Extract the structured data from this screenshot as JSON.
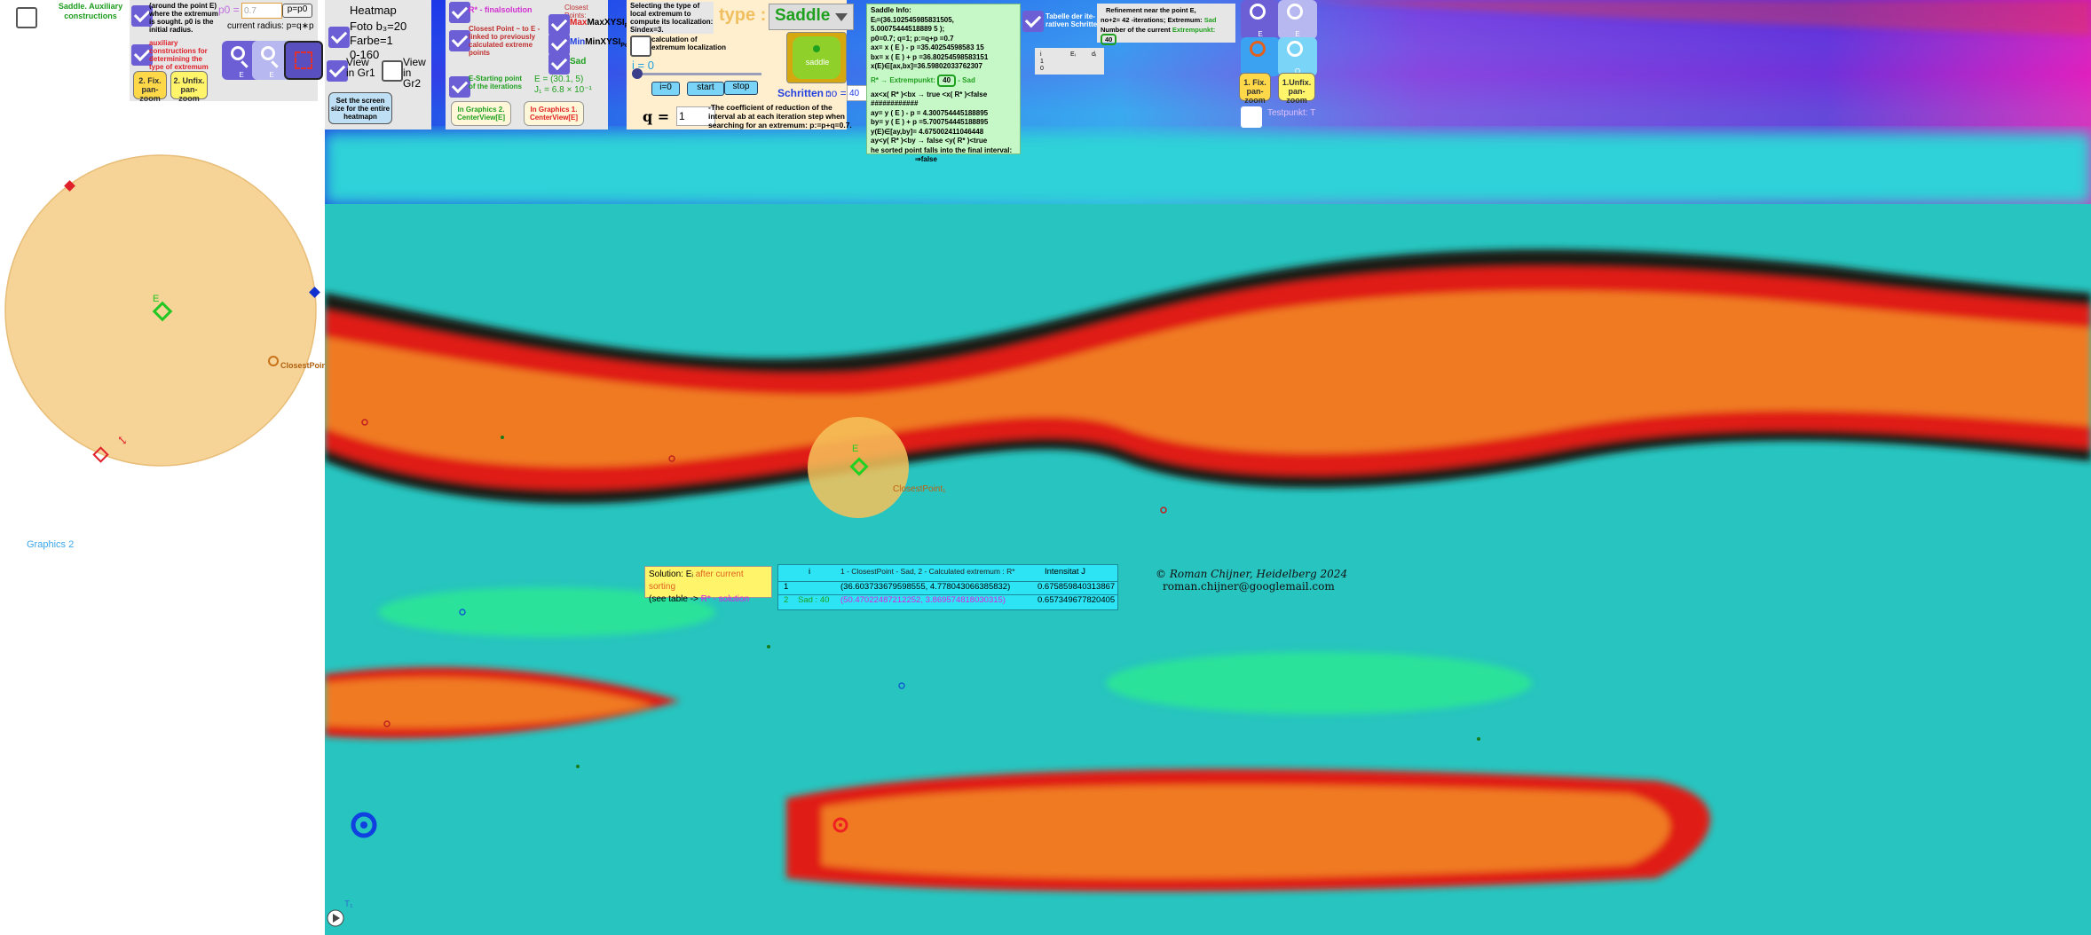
{
  "left_panel": {
    "saddle_aux_label": "Saddle. Auxiliary constructions",
    "around_point_text": "(around the point E) where the extremum is sought. p0 is the initial radius.",
    "p0_label": "p0 =",
    "p0_value": "0.7",
    "p_eq_p0_button": "p=p0",
    "current_radius": "current radius: p=q∗p",
    "aux_constructions_text": "auxiliary constructions for determining the type of extremum",
    "fix_pan_zoom_2": "2. Fix. pan-zoom",
    "unfix_pan_zoom_2": "2. Unfix. pan-zoom",
    "point_E_label": "E",
    "closest_point_label": "ClosestPoint,",
    "graphics2_label": "Graphics 2",
    "zoom_in_sub": "E",
    "zoom_out_sub": "E"
  },
  "heatmap_panel": {
    "title": "Heatmap",
    "foto_line": "Foto b₃=20",
    "farbe_line": "Farbe=1",
    "range_line": "0-160",
    "view_gr1": "View in Gr1",
    "view_gr2": "View in Gr2",
    "screen_button": "Set the screen size for the entire heatmapn"
  },
  "solution_panel": {
    "rstar_label": "R* - finalsolution",
    "closest_points_header": "Closest Points:",
    "maxxysi": "MaxXYSI",
    "minxysi": "MinXYSI",
    "poly_sub": "Poly",
    "sad": "Sad",
    "closest_linked": "Closest Point ~ to E -linked to previously calculated extreme points",
    "e_start": "E-Starting point of the iterations",
    "e_value": "E = (30.1, 5)",
    "j_value": "J₁ = 6.8 × 10⁻¹",
    "in_graphics2": "In Graphics 2. CenterView[E]",
    "in_graphics1": "In Graphics 1. CenterView[E]"
  },
  "type_panel": {
    "selecting_text": "Selecting the type of local extremum to compute its localization: Sindex=3.",
    "type_label": "type :",
    "type_value": "Saddle",
    "calc_label": "calculation of extremum localization",
    "i_label": "i = 0",
    "i0_button": "i=0",
    "start_button": "start",
    "stop_button": "stop",
    "schritten_label": "Schritten :",
    "no_label": "no =",
    "no_value": "40",
    "q_label": "q =",
    "q_value": "1",
    "coef_text": "-The coefficient of reduction of the interval ab at each iteration step when searching for an extremum: p:=p+q=0.7.",
    "saddle_icon_label": "saddle",
    "slider_value": 0
  },
  "saddle_info": {
    "title": "Saddle Info:",
    "lines": [
      "Eᵢ=(36.102545985831505, 5.00075444518889 5 );",
      "p0=0.7; q=1;   p:=q+p =0.7",
      "ax= x ( E ) - p =35.40254598583 15",
      "bx= x ( E ) + p =36.80254598583151",
      "    x(E)∈[ax,bx]=36.59802033762307"
    ],
    "rstar_line": "R* →    Extrempunkt:",
    "extrempunkt_value": "40",
    "sad_text": "- Sad",
    "ax_line": "ax<x( R* )<bx → true <x( R* )<false",
    "hash_line": "############",
    "ay_line": "ay= y ( E ) - p = 4.300754445188895",
    "by_line": "by= y ( E ) + p =5.700754445188895",
    "ye_line": "   y(E)∈[ay,by]= 4.675002411046448",
    "ay2_line": "  ay<y( R* )<by → false <y( R* )<true",
    "sorted_line": "he sorted point falls into the final interval:",
    "result_line": "⇒false"
  },
  "tabelle": {
    "label": "Tabelle der ite- rativen Schritte",
    "mini_headers": [
      "i",
      "Eᵢ",
      "dᵢ"
    ],
    "mini_rows": [
      "1",
      "0"
    ]
  },
  "refinement": {
    "title": "Refinement near the point E,",
    "iter_line": "no+2=  42 -iterations;  Extremum:",
    "extremum_value": "Sad",
    "number_label": "Number of the current",
    "extrempunkt_label": "Extrempunkt:",
    "extrempunkt_value": "40"
  },
  "right_tools": {
    "fix_pan_zoom_1": "1. Fix. pan-zoom",
    "unfix_pan_zoom_1": "1.Unfix. pan-zoom",
    "testpunkt": "Testpunkt: T",
    "zoom_sub_e": "E",
    "zoom_sub_o": "O"
  },
  "heatmap_labels": {
    "e_label": "E",
    "closest_label": "ClosestPoint₁",
    "play_label": "T₁"
  },
  "bottom": {
    "solution_line1a": "Solution: Eᵢ",
    "solution_line1b": " after current sorting",
    "solution_line2a": "(see table -> ",
    "solution_line2b": "R*",
    "solution_line2c": " - solution",
    "table_headers": [
      "",
      "i",
      "1 - ClosestPoint  - Sad, 2 - Calculated extremum : R*",
      "Intensitat J"
    ],
    "table_rows": [
      {
        "n": "1",
        "i": "",
        "point": "(36.603733679598555, 4.778043066385832)",
        "j": "0.675859840313867"
      },
      {
        "n": "2",
        "i": "Sad : 40",
        "point": "(50.47022487212252, 3.869574818030315)",
        "j": "0.657349677820405"
      }
    ],
    "copyright": "©  Roman Chijner, Heidelberg 2024",
    "email": "roman.chijner@googlemail.com"
  }
}
